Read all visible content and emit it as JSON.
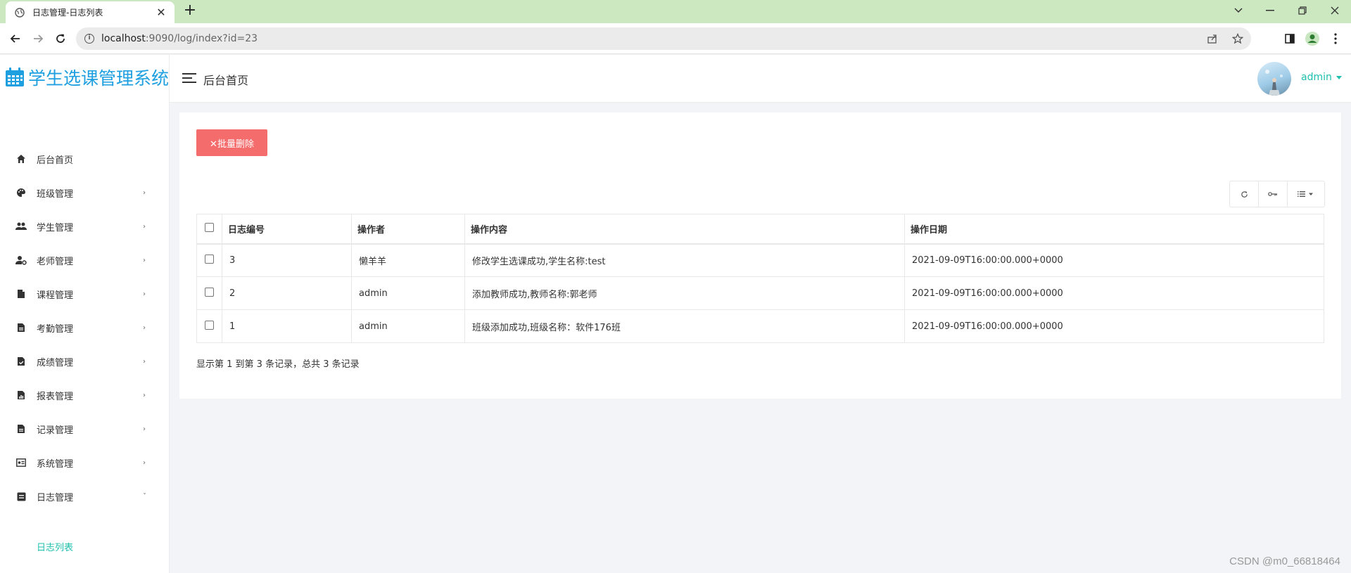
{
  "browser": {
    "tab_title": "日志管理-日志列表",
    "url_host": "localhost",
    "url_path": ":9090/log/index?id=23"
  },
  "app": {
    "title": "学生选课管理系统",
    "breadcrumb": "后台首页",
    "username": "admin"
  },
  "sidebar": {
    "items": [
      {
        "label": "后台首页",
        "icon": "home-icon",
        "has_arrow": false
      },
      {
        "label": "班级管理",
        "icon": "palette-icon",
        "has_arrow": true
      },
      {
        "label": "学生管理",
        "icon": "people-icon",
        "has_arrow": true
      },
      {
        "label": "老师管理",
        "icon": "user-gear-icon",
        "has_arrow": true
      },
      {
        "label": "课程管理",
        "icon": "file-icon",
        "has_arrow": true
      },
      {
        "label": "考勤管理",
        "icon": "file-text-icon",
        "has_arrow": true
      },
      {
        "label": "成绩管理",
        "icon": "file-check-icon",
        "has_arrow": true
      },
      {
        "label": "报表管理",
        "icon": "file-chart-icon",
        "has_arrow": true
      },
      {
        "label": "记录管理",
        "icon": "file-text-icon",
        "has_arrow": true
      },
      {
        "label": "系统管理",
        "icon": "system-icon",
        "has_arrow": true
      },
      {
        "label": "日志管理",
        "icon": "log-icon",
        "expanded": true
      }
    ],
    "sub_items": [
      {
        "label": "日志列表",
        "active": true
      }
    ]
  },
  "toolbar": {
    "batch_delete_label": "✕批量删除"
  },
  "table": {
    "columns": [
      "日志编号",
      "操作者",
      "操作内容",
      "操作日期"
    ],
    "rows": [
      {
        "id": "3",
        "operator": "懒羊羊",
        "content": "修改学生选课成功,学生名称:test",
        "date": "2021-09-09T16:00:00.000+0000"
      },
      {
        "id": "2",
        "operator": "admin",
        "content": "添加教师成功,教师名称:郭老师",
        "date": "2021-09-09T16:00:00.000+0000"
      },
      {
        "id": "1",
        "operator": "admin",
        "content": "班级添加成功,班级名称：软件176班",
        "date": "2021-09-09T16:00:00.000+0000"
      }
    ]
  },
  "pagination": {
    "summary": "显示第 1 到第 3 条记录，总共 3 条记录"
  },
  "watermark": "CSDN @m0_66818464",
  "colors": {
    "accent": "#1fbfae",
    "logo": "#1e9fe0",
    "danger": "#f56c6c"
  }
}
